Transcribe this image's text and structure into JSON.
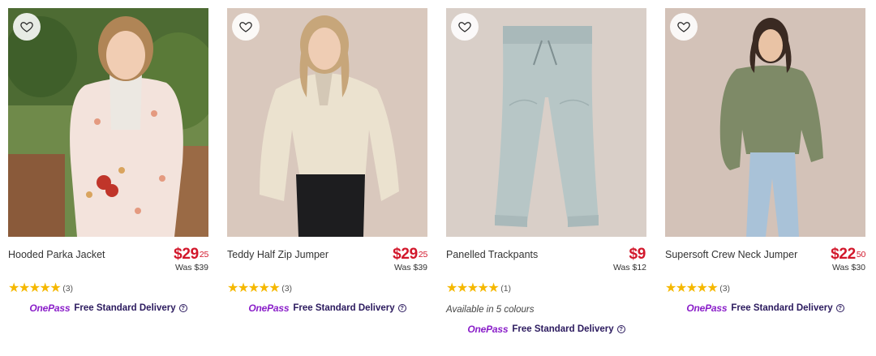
{
  "colors": {
    "price": "#d2172b",
    "stars": "#f5b800",
    "onepass_logo": "#8a1ec9",
    "onepass_text": "#2b1a5e"
  },
  "products": [
    {
      "name": "Hooded Parka Jacket",
      "price_main": "$29",
      "price_cents": "25",
      "was": "Was $39",
      "stars": "★★★★★",
      "rating_value": 5,
      "reviews": "(3)",
      "colours": "",
      "onepass_logo": "OnePass",
      "delivery": "Free Standard Delivery",
      "help": "?"
    },
    {
      "name": "Teddy Half Zip Jumper",
      "price_main": "$29",
      "price_cents": "25",
      "was": "Was $39",
      "stars": "★★★★★",
      "rating_value": 5,
      "reviews": "(3)",
      "colours": "",
      "onepass_logo": "OnePass",
      "delivery": "Free Standard Delivery",
      "help": "?"
    },
    {
      "name": "Panelled Trackpants",
      "price_main": "$9",
      "price_cents": "",
      "was": "Was $12",
      "stars": "★★★★★",
      "rating_value": 5,
      "reviews": "(1)",
      "colours": "Available in 5 colours",
      "onepass_logo": "OnePass",
      "delivery": "Free Standard Delivery",
      "help": "?"
    },
    {
      "name": "Supersoft Crew Neck Jumper",
      "price_main": "$22",
      "price_cents": "50",
      "was": "Was $30",
      "stars": "★★★★★",
      "rating_value": 5,
      "reviews": "(3)",
      "colours": "",
      "onepass_logo": "OnePass",
      "delivery": "Free Standard Delivery",
      "help": "?"
    }
  ]
}
